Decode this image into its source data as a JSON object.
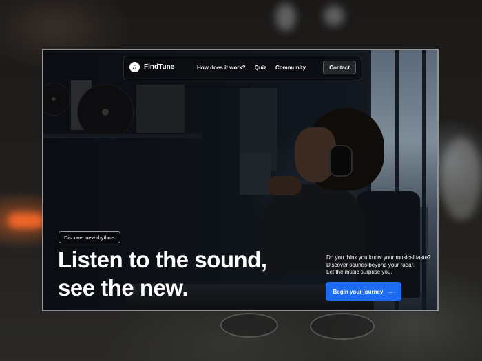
{
  "brand": {
    "name": "FindTune",
    "logo_icon": "music-note-icon"
  },
  "nav": {
    "links": [
      "How does it work?",
      "Quiz",
      "Community"
    ],
    "contact_label": "Contact"
  },
  "hero": {
    "badge": "Discover new rhythms",
    "headline_line1": "Listen to the sound,",
    "headline_line2": "see the new.",
    "side_line1": "Do you think you know your musical taste?",
    "side_line2": "Discover sounds beyond your radar.",
    "side_line3": "Let the music surprise you.",
    "cta_label": "Begin your journey",
    "cta_icon": "arrow-right-icon"
  },
  "colors": {
    "accent": "#1e6cf0",
    "background": "#0d1117",
    "text": "#ffffff"
  }
}
